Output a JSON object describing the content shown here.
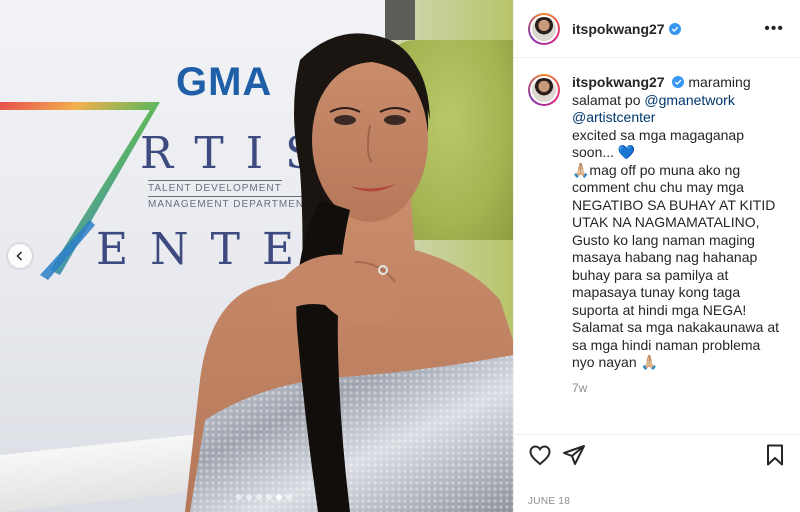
{
  "post": {
    "username": "itspokwang27",
    "verified": true,
    "caption": {
      "lead": "maraming salamat po",
      "mention1": "@gmanetwork",
      "mention2": "@artistcenter",
      "body": "excited sa mga magaganap soon... 💙\n🙏🏼mag off po muna ako ng comment chu chu may mga NEGATIBO SA BUHAY AT KITID UTAK NA NAGMAMATALINO, Gusto ko lang naman maging masaya habang nag hahanap buhay para sa pamilya at mapasaya tunay kong taga suporta at hindi mga NEGA! Salamat sa mga nakakaunawa at sa mga hindi naman problema nyo nayan 🙏🏼"
    },
    "age": "7w",
    "date": "JUNE 18"
  },
  "photo": {
    "logo_gma": "GMA",
    "logo_artist": "RTIS",
    "logo_center": "ENTE",
    "logo_sub1": "TALENT DEVELOPMENT",
    "logo_sub2": "MANAGEMENT DEPARTMENT",
    "carousel": {
      "count": 6,
      "active": 5
    }
  },
  "icons": {
    "more": "more-options-icon",
    "like": "heart-icon",
    "share": "paper-plane-icon",
    "save": "bookmark-icon",
    "prev": "chevron-left-icon",
    "verified": "verified-badge-icon"
  },
  "colors": {
    "verified": "#3897f0",
    "link": "#00376b",
    "muted": "#8e8e8e"
  }
}
